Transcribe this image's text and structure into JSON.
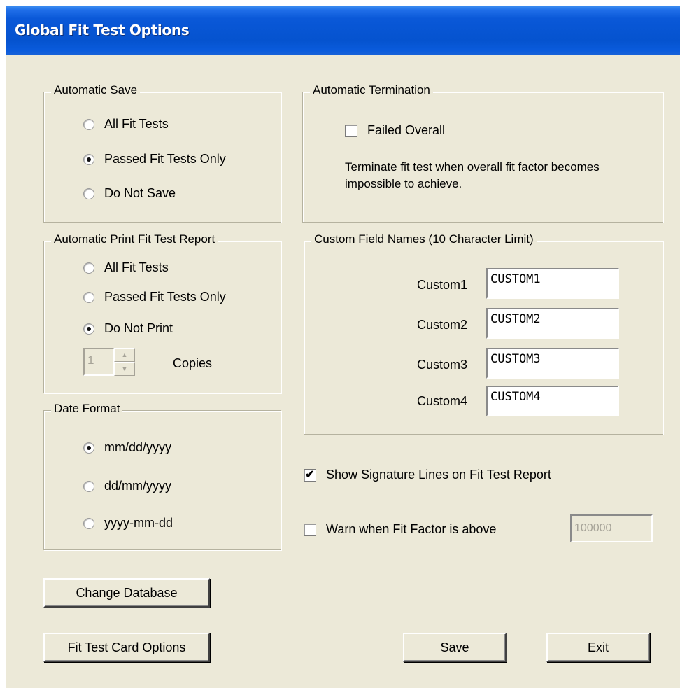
{
  "window": {
    "title": "Global Fit Test Options"
  },
  "auto_save": {
    "legend": "Automatic Save",
    "options": [
      "All Fit Tests",
      "Passed Fit Tests Only",
      "Do Not Save"
    ],
    "selected": "Passed Fit Tests Only"
  },
  "auto_print": {
    "legend": "Automatic Print Fit Test Report",
    "options": [
      "All Fit Tests",
      "Passed Fit Tests Only",
      "Do Not Print"
    ],
    "selected": "Do Not Print",
    "copies_value": "1",
    "copies_label": "Copies"
  },
  "date_format": {
    "legend": "Date Format",
    "options": [
      "mm/dd/yyyy",
      "dd/mm/yyyy",
      "yyyy-mm-dd"
    ],
    "selected": "mm/dd/yyyy"
  },
  "auto_term": {
    "legend": "Automatic Termination",
    "failed_overall_label": "Failed Overall",
    "failed_overall_checked": false,
    "description": "Terminate fit test when overall fit factor becomes impossible to achieve."
  },
  "custom_fields": {
    "legend": "Custom Field Names (10 Character Limit)",
    "fields": [
      {
        "label": "Custom1",
        "value": "CUSTOM1"
      },
      {
        "label": "Custom2",
        "value": "CUSTOM2"
      },
      {
        "label": "Custom3",
        "value": "CUSTOM3"
      },
      {
        "label": "Custom4",
        "value": "CUSTOM4"
      }
    ]
  },
  "show_signature": {
    "label": "Show Signature Lines on Fit Test Report",
    "checked": true
  },
  "warn_fit_factor": {
    "label": "Warn when Fit Factor is above",
    "checked": false,
    "value": "100000"
  },
  "buttons": {
    "change_database": "Change Database",
    "fit_test_card_options": "Fit Test Card Options",
    "save": "Save",
    "exit": "Exit"
  },
  "glyphs": {
    "check": "✔",
    "spin_up": "▲",
    "spin_down": "▼"
  }
}
